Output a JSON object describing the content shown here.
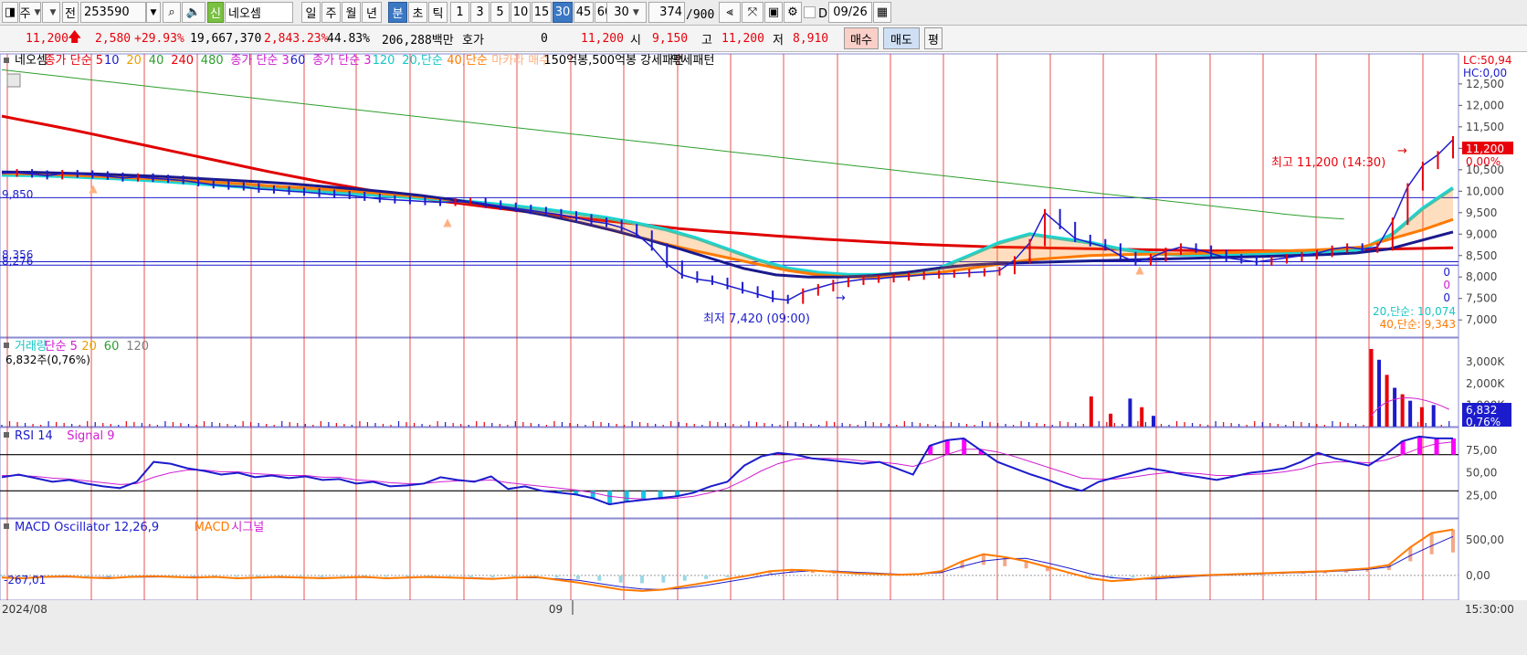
{
  "toolbar": {
    "period_btn": "주",
    "prev_btn": "전",
    "code": "253590",
    "badge": "신",
    "stock_name": "네오셈",
    "periods": [
      "일",
      "주",
      "월",
      "년",
      "분",
      "초",
      "틱"
    ],
    "active_period": "분",
    "intervals": [
      "1",
      "3",
      "5",
      "10",
      "15",
      "30",
      "45",
      "60"
    ],
    "active_interval": "30",
    "interval_select": "30",
    "count": "374",
    "count_total": "/900",
    "date_check": "D",
    "date": "09/26"
  },
  "quote": {
    "price": "11,200",
    "change": "2,580",
    "change_pct": "+29.93%",
    "volume": "19,667,370",
    "vol_ratio": "2,843.23%",
    "turnover": "44.83%",
    "amount": "206,288백만",
    "hoga_label": "호가",
    "hoga_value": "0",
    "hoga_price": "11,200",
    "open_label": "시",
    "open": "9,150",
    "high_label": "고",
    "high": "11,200",
    "low_label": "저",
    "low": "8,910",
    "buy": "매수",
    "sell": "매도",
    "eval": "평"
  },
  "colors": {
    "up": "#e8000b",
    "down": "#1c1ccc",
    "accent": "#3b78c4"
  },
  "chart_data": {
    "type": "line",
    "price_panel": {
      "legend": [
        {
          "text": "네오셈",
          "color": "#000000"
        },
        {
          "text": "종가 단순 5",
          "color": "#e8000b"
        },
        {
          "text": "10",
          "color": "#1c1ccc"
        },
        {
          "text": "20",
          "color": "#e8a000"
        },
        {
          "text": "40",
          "color": "#2e9e2e"
        },
        {
          "text": "240",
          "color": "#e8000b"
        },
        {
          "text": "480",
          "color": "#2e9e2e"
        },
        {
          "text": "종가 단순 3",
          "color": "#d020d0"
        },
        {
          "text": "60",
          "color": "#1c1ccc"
        },
        {
          "text": "종가 단순 3",
          "color": "#d020d0"
        },
        {
          "text": "120",
          "color": "#17c6c6"
        },
        {
          "text": "20,단순",
          "color": "#17c6c6"
        },
        {
          "text": "40,단순",
          "color": "#ff7a00"
        },
        {
          "text": "마카라 매수",
          "color": "#ffb080"
        },
        {
          "text": "150억봉,500억봉 강세패턴",
          "color": "#000000"
        },
        {
          "text": "약세패턴",
          "color": "#000000"
        }
      ],
      "y_ticks": [
        "12,500",
        "12,000",
        "11,500",
        "11,000",
        "10,500",
        "10,000",
        "9,500",
        "9,000",
        "8,500",
        "8,000",
        "7,500",
        "7,000"
      ],
      "ylim": [
        6600,
        13200
      ],
      "top_right": [
        "LC:50,94",
        "HC:0,00"
      ],
      "current_price_tag": "11,200",
      "current_pct_tag": "0,00%",
      "high_annotation": "최고 11,200 (14:30)",
      "low_annotation": "최저 7,420 (09:00)",
      "left_level_labels": [
        "9,850",
        "8,356",
        "8,276"
      ],
      "right_small_labels": [
        "0",
        "0",
        "0"
      ],
      "ma_labels": [
        {
          "text": "20,단순: 10,074",
          "color": "#17c6c6"
        },
        {
          "text": "40,단순: 9,343",
          "color": "#ff7a00"
        }
      ],
      "close": [
        10420,
        10430,
        10400,
        10360,
        10410,
        10400,
        10380,
        10350,
        10310,
        10330,
        10300,
        10280,
        10250,
        10200,
        10150,
        10120,
        10100,
        10050,
        10030,
        10000,
        9980,
        9950,
        9920,
        9900,
        9860,
        9820,
        9800,
        9780,
        9760,
        9740,
        9750,
        9760,
        9700,
        9650,
        9600,
        9550,
        9500,
        9450,
        9380,
        9300,
        9250,
        9150,
        9000,
        8700,
        8300,
        8050,
        7950,
        7900,
        7800,
        7700,
        7600,
        7500,
        7460,
        7650,
        7750,
        7850,
        7900,
        7950,
        7960,
        8000,
        8020,
        8050,
        8070,
        8080,
        8100,
        8120,
        8150,
        8400,
        8800,
        9500,
        9200,
        8900,
        8800,
        8700,
        8500,
        8350,
        8450,
        8600,
        8700,
        8650,
        8550,
        8450,
        8400,
        8350,
        8400,
        8450,
        8500,
        8550,
        8650,
        8700,
        8650,
        8700,
        9300,
        10100,
        10600,
        10850,
        11200
      ],
      "ma_long": [
        11750,
        11640,
        11530,
        11420,
        11300,
        11180,
        11060,
        10940,
        10820,
        10700,
        10580,
        10460,
        10350,
        10240,
        10140,
        10040,
        9950,
        9860,
        9780,
        9710,
        9640,
        9570,
        9500,
        9430,
        9370,
        9310,
        9250,
        9190,
        9130,
        9080,
        9040,
        9000,
        8960,
        8920,
        8880,
        8850,
        8820,
        8790,
        8760,
        8740,
        8720,
        8700,
        8690,
        8680,
        8670,
        8660,
        8650,
        8640,
        8630,
        8620,
        8610,
        8610,
        8610,
        8610,
        8620,
        8630,
        8640,
        8650,
        8660,
        8670,
        8680
      ],
      "ma_480": [
        12830,
        12750,
        12670,
        12590,
        12510,
        12430,
        12350,
        12270,
        12190,
        12110,
        12030,
        11950,
        11870,
        11790,
        11710,
        11630,
        11550,
        11470,
        11390,
        11310,
        11230,
        11150,
        11070,
        10990,
        10910,
        10830,
        10750,
        10670,
        10590,
        10510,
        10430,
        10350,
        10270,
        10190,
        10110,
        10030,
        9950,
        9870,
        9790,
        9710,
        9630,
        9550,
        9470,
        9400,
        9350
      ],
      "ma20_cyan": [
        10380,
        10370,
        10350,
        10320,
        10290,
        10250,
        10200,
        10150,
        10100,
        10060,
        10020,
        9980,
        9930,
        9880,
        9830,
        9780,
        9720,
        9650,
        9570,
        9480,
        9380,
        9250,
        9100,
        8900,
        8650,
        8400,
        8200,
        8100,
        8050,
        8050,
        8100,
        8200,
        8500,
        8800,
        9000,
        8900,
        8800,
        8650,
        8550,
        8520,
        8520,
        8540,
        8560,
        8580,
        8600,
        8650,
        9000,
        9600,
        10074
      ],
      "ma40_orange": [
        10420,
        10400,
        10380,
        10350,
        10320,
        10290,
        10250,
        10210,
        10170,
        10120,
        10080,
        10030,
        9980,
        9920,
        9860,
        9780,
        9690,
        9580,
        9440,
        9290,
        9120,
        8940,
        8760,
        8600,
        8450,
        8300,
        8150,
        8050,
        8000,
        8000,
        8030,
        8100,
        8200,
        8300,
        8400,
        8450,
        8500,
        8520,
        8530,
        8540,
        8560,
        8580,
        8600,
        8620,
        8650,
        8700,
        8900,
        9100,
        9343
      ],
      "ma60_navy": [
        10450,
        10440,
        10420,
        10400,
        10370,
        10340,
        10300,
        10260,
        10220,
        10170,
        10110,
        10050,
        9980,
        9900,
        9800,
        9690,
        9560,
        9420,
        9260,
        9080,
        8880,
        8660,
        8430,
        8200,
        8050,
        8000,
        8000,
        8030,
        8100,
        8200,
        8280,
        8320,
        8340,
        8360,
        8380,
        8400,
        8420,
        8440,
        8460,
        8480,
        8500,
        8520,
        8560,
        8650,
        8850,
        9050
      ]
    },
    "volume_panel": {
      "legend": [
        {
          "text": "거래량",
          "color": "#17c6c6"
        },
        {
          "text": "단순 5",
          "color": "#d020d0"
        },
        {
          "text": "20",
          "color": "#e8a000"
        },
        {
          "text": "60",
          "color": "#2e9e2e"
        },
        {
          "text": "120",
          "color": "#808080"
        }
      ],
      "sub_label": "6,832주(0,76%)",
      "y_ticks": [
        "3,000K",
        "2,000K",
        "1,000K"
      ],
      "ylim": [
        0,
        3600000
      ],
      "last_tag": "6,832",
      "pct_tag": "0,76%",
      "spikes": [
        {
          "i": 280,
          "v": 1400000,
          "up": true
        },
        {
          "i": 285,
          "v": 600000,
          "up": true
        },
        {
          "i": 290,
          "v": 1300000,
          "up": false
        },
        {
          "i": 293,
          "v": 900000,
          "up": true
        },
        {
          "i": 296,
          "v": 500000,
          "up": false
        },
        {
          "i": 352,
          "v": 3600000,
          "up": true
        },
        {
          "i": 354,
          "v": 3100000,
          "up": false
        },
        {
          "i": 356,
          "v": 2400000,
          "up": true
        },
        {
          "i": 358,
          "v": 1800000,
          "up": false
        },
        {
          "i": 360,
          "v": 1500000,
          "up": true
        },
        {
          "i": 362,
          "v": 1200000,
          "up": false
        },
        {
          "i": 365,
          "v": 900000,
          "up": true
        },
        {
          "i": 368,
          "v": 1000000,
          "up": false
        }
      ]
    },
    "rsi_panel": {
      "legend": [
        {
          "text": "RSI 14",
          "color": "#1c1ccc"
        },
        {
          "text": "Signal 9",
          "color": "#d020d0"
        }
      ],
      "y_ticks": [
        "75,00",
        "50,00",
        "25,00"
      ],
      "levels": [
        70,
        30
      ],
      "ylim": [
        0,
        100
      ],
      "rsi": [
        45,
        48,
        44,
        40,
        42,
        38,
        35,
        33,
        40,
        62,
        60,
        55,
        52,
        48,
        50,
        45,
        47,
        44,
        46,
        42,
        43,
        38,
        40,
        35,
        36,
        38,
        45,
        42,
        40,
        46,
        32,
        35,
        30,
        28,
        26,
        22,
        15,
        18,
        20,
        22,
        24,
        28,
        35,
        40,
        58,
        68,
        72,
        70,
        66,
        64,
        62,
        60,
        62,
        55,
        48,
        80,
        86,
        88,
        75,
        62,
        55,
        48,
        42,
        35,
        30,
        40,
        45,
        50,
        55,
        52,
        48,
        45,
        42,
        46,
        50,
        52,
        55,
        62,
        72,
        66,
        62,
        58,
        70,
        85,
        90,
        88,
        88
      ],
      "signal": [
        47,
        47,
        46,
        44,
        43,
        41,
        39,
        37,
        38,
        45,
        50,
        53,
        53,
        51,
        51,
        49,
        48,
        47,
        47,
        45,
        45,
        42,
        41,
        39,
        38,
        38,
        40,
        41,
        41,
        42,
        39,
        37,
        35,
        33,
        31,
        28,
        24,
        22,
        21,
        21,
        22,
        24,
        28,
        33,
        42,
        52,
        60,
        65,
        66,
        66,
        65,
        63,
        62,
        60,
        57,
        63,
        70,
        76,
        76,
        73,
        68,
        62,
        56,
        50,
        44,
        43,
        43,
        45,
        48,
        50,
        50,
        49,
        47,
        47,
        48,
        49,
        51,
        54,
        60,
        62,
        62,
        61,
        64,
        70,
        77,
        82,
        84
      ]
    },
    "macd_panel": {
      "legend": [
        {
          "text": "MACD Oscillator 12,26,9",
          "color": "#1c1ccc"
        },
        {
          "text": "MACD",
          "color": "#ff7a00"
        },
        {
          "text": "시그널",
          "color": "#d020d0"
        }
      ],
      "y_ticks": [
        "500,00",
        "0,00"
      ],
      "ylim": [
        -350,
        800
      ],
      "left_value": "-267,01",
      "macd": [
        -30,
        -40,
        -20,
        -10,
        -30,
        -40,
        -20,
        -10,
        -20,
        -30,
        -20,
        -40,
        -30,
        -20,
        -30,
        -40,
        -30,
        -20,
        -40,
        -30,
        -20,
        -30,
        -40,
        -50,
        -30,
        -20,
        -60,
        -100,
        -150,
        -200,
        -220,
        -200,
        -150,
        -100,
        -50,
        0,
        60,
        80,
        70,
        50,
        30,
        20,
        10,
        20,
        60,
        200,
        300,
        260,
        200,
        120,
        40,
        -40,
        -80,
        -60,
        -30,
        -10,
        0,
        10,
        20,
        30,
        40,
        50,
        60,
        80,
        100,
        150,
        400,
        600,
        650
      ]
    },
    "x_labels": [
      {
        "text": "2024/08",
        "pos": 0
      },
      {
        "text": "09",
        "pos": 0.375
      }
    ],
    "time_label": "15:30:00"
  }
}
